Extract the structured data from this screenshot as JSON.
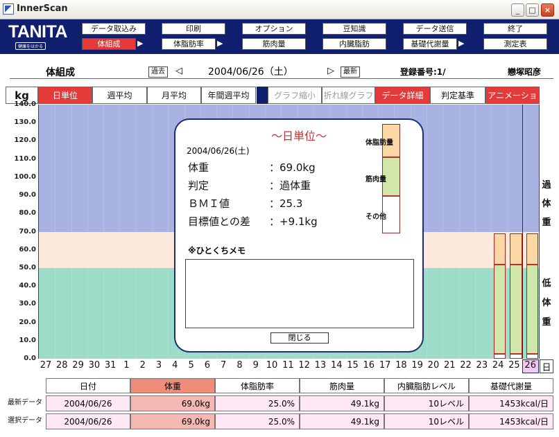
{
  "window": {
    "title": "InnerScan",
    "min": "_",
    "max": "□",
    "close": "×"
  },
  "logo": {
    "brand": "TANITA",
    "tagline": "健康をはかる"
  },
  "toolbar": {
    "row1": [
      "データ取込み",
      "印刷",
      "オプション",
      "豆知識",
      "データ送信",
      "終了"
    ],
    "row2": [
      "体組成",
      "体脂肪率",
      "筋肉量",
      "内臓脂肪",
      "基礎代謝量",
      "測定表"
    ],
    "arrow": "▶"
  },
  "header": {
    "section": "体組成",
    "prev": "過去",
    "latest": "最新",
    "date": "2004/06/26（土）",
    "reg_label": "登録番号:1/",
    "user": "戀塚昭彦",
    "left": "◁",
    "right": "▷"
  },
  "tabs": [
    "kg",
    "日単位",
    "週平均",
    "月平均",
    "年間週平均",
    "グラフ縮小",
    "折れ線グラフ",
    "データ詳細",
    "判定基準",
    "アニメーション"
  ],
  "chart_data": {
    "type": "bar",
    "ylim": [
      0,
      140
    ],
    "yticks": [
      "140.0",
      "130.0",
      "120.0",
      "110.0",
      "100.0",
      "90.0",
      "80.0",
      "70.0",
      "60.0",
      "50.0",
      "40.0",
      "30.0",
      "20.0",
      "10.0",
      "0.0"
    ],
    "categories": [
      "27",
      "28",
      "29",
      "30",
      "31",
      "1",
      "2",
      "3",
      "4",
      "5",
      "6",
      "7",
      "8",
      "9",
      "10",
      "11",
      "12",
      "13",
      "14",
      "15",
      "16",
      "17",
      "18",
      "19",
      "20",
      "21",
      "22",
      "23",
      "24",
      "25",
      "26"
    ],
    "unit_label": "日",
    "bands": [
      {
        "label": "過体重",
        "from": 70,
        "to": 140,
        "color": "#a9b3e3"
      },
      {
        "label": "",
        "from": 50,
        "to": 70,
        "color": "#fbe9dc"
      },
      {
        "label": "低体重",
        "from": 0,
        "to": 50,
        "color": "#9ddcc9"
      }
    ],
    "series": [
      {
        "name": "体脂肪量",
        "values": {
          "24": 17.2,
          "25": 17.2,
          "26": 17.2
        },
        "color": "#fbd7a6"
      },
      {
        "name": "筋肉量",
        "values": {
          "24": 49.1,
          "25": 49.1,
          "26": 49.1
        },
        "color": "#cfe8a9"
      },
      {
        "name": "その他",
        "values": {
          "24": 2.7,
          "25": 2.7,
          "26": 2.7
        },
        "color": "#ffffff"
      }
    ],
    "totals": {
      "24": 69.0,
      "25": 69.0,
      "26": 69.0
    },
    "selected": "26"
  },
  "side": {
    "upper": [
      "過",
      "体",
      "重"
    ],
    "lower": [
      "低",
      "体",
      "重"
    ]
  },
  "modal": {
    "title": "〜日単位〜",
    "date": "2004/06/26(土)",
    "rows": [
      {
        "k": "体重",
        "v": "：69.0kg"
      },
      {
        "k": "判定",
        "v": "：過体重"
      },
      {
        "k": "ＢＭＩ値",
        "v": "：25.3"
      },
      {
        "k": "目標値との差",
        "v": "：+9.1kg"
      }
    ],
    "memo_label": "※ひとくちメモ",
    "close": "閉じる",
    "legend": [
      "体脂肪量",
      "筋肉量",
      "その他"
    ]
  },
  "table": {
    "headers": [
      "日付",
      "体重",
      "体脂肪率",
      "筋肉量",
      "内臓脂肪レベル",
      "基礎代謝量"
    ],
    "rows": [
      {
        "label": "最新データ",
        "cells": [
          "2004/06/26",
          "69.0kg",
          "25.0%",
          "49.1kg",
          "10レベル",
          "1453kcal/日"
        ]
      },
      {
        "label": "選択データ",
        "cells": [
          "2004/06/26",
          "69.0kg",
          "25.0%",
          "49.1kg",
          "10レベル",
          "1453kcal/日"
        ]
      }
    ]
  }
}
